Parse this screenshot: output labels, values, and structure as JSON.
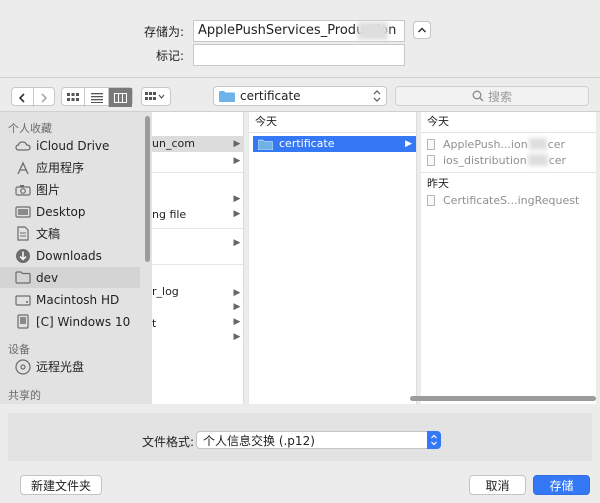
{
  "save_form": {
    "save_as_label": "存储为:",
    "filename_value": "ApplePushServices_Production",
    "tags_label": "标记:",
    "tags_value": ""
  },
  "toolbar": {
    "location": "certificate",
    "search_placeholder": "搜索"
  },
  "sidebar": {
    "favorites_header": "个人收藏",
    "favorites": [
      {
        "label": "iCloud Drive",
        "icon": "cloud-icon"
      },
      {
        "label": "应用程序",
        "icon": "applications-icon"
      },
      {
        "label": "图片",
        "icon": "camera-icon"
      },
      {
        "label": "Desktop",
        "icon": "desktop-icon"
      },
      {
        "label": "文稿",
        "icon": "document-icon"
      },
      {
        "label": "Downloads",
        "icon": "download-icon"
      },
      {
        "label": "dev",
        "icon": "folder-icon"
      },
      {
        "label": "Macintosh HD",
        "icon": "harddisk-icon"
      },
      {
        "label": "[C] Windows 10",
        "icon": "disk-icon"
      }
    ],
    "devices_header": "设备",
    "devices": [
      {
        "label": "远程光盘",
        "icon": "optical-disc-icon"
      }
    ],
    "shared_header": "共享的"
  },
  "column1": {
    "rows": [
      {
        "label": "un_com",
        "has_arrow": true
      },
      {
        "label": "",
        "has_arrow": true
      },
      {
        "label": "",
        "has_arrow": true
      },
      {
        "label": "ng file",
        "has_arrow": true
      },
      {
        "label": "",
        "has_arrow": true
      },
      {
        "label": "r_log",
        "has_arrow": true
      },
      {
        "label": "",
        "has_arrow": true
      },
      {
        "label": "t",
        "has_arrow": true
      },
      {
        "label": "",
        "has_arrow": true
      }
    ]
  },
  "column2": {
    "header": "今天",
    "selected_folder": "certificate"
  },
  "column3": {
    "today_header": "今天",
    "today_files": [
      "ApplePush...ion",
      "ios_distribution"
    ],
    "today_suffixes": [
      "cer",
      "cer"
    ],
    "yesterday_header": "昨天",
    "yesterday_files": [
      "CertificateS...ingRequest"
    ]
  },
  "bottom": {
    "format_label": "文件格式:",
    "format_value": "个人信息交换 (.p12)"
  },
  "buttons": {
    "new_folder": "新建文件夹",
    "cancel": "取消",
    "save": "存储"
  },
  "colors": {
    "accent": "#3478f6",
    "folder": "#6fb2e8"
  }
}
